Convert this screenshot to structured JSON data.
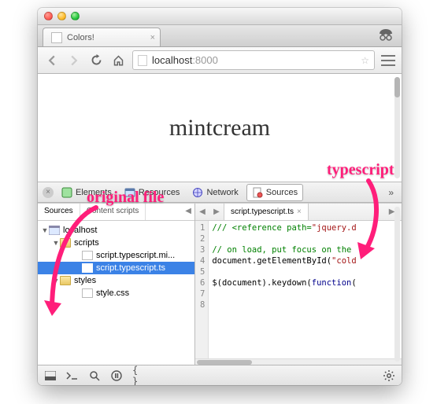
{
  "tab": {
    "title": "Colors!"
  },
  "url": {
    "host": "localhost",
    "port": ":8000"
  },
  "page": {
    "text": "mintcream"
  },
  "devtools": {
    "panels": [
      "Elements",
      "Resources",
      "Network",
      "Sources"
    ],
    "sources_tabs": [
      "Sources",
      "Content scripts"
    ],
    "tree": {
      "domain": "localhost",
      "folder_scripts": "scripts",
      "file_min": "script.typescript.mi...",
      "file_ts": "script.typescript.ts",
      "folder_styles": "styles",
      "file_css": "style.css"
    },
    "open_file": "script.typescript.ts",
    "gutter": [
      "1",
      "2",
      "3",
      "4",
      "5",
      "6",
      "7",
      "8"
    ],
    "code": {
      "l1a": "/// <reference path=",
      "l1b": "\"jquery.d",
      "l2": "",
      "l3": "// on load, put focus on the ",
      "l4a": "document.getElementById(",
      "l4b": "\"cold",
      "l5": "",
      "l6a": "$(document).keydown(",
      "l6b": "function",
      "l6c": "("
    }
  },
  "annotations": {
    "left": "original file",
    "right": "typescript"
  }
}
